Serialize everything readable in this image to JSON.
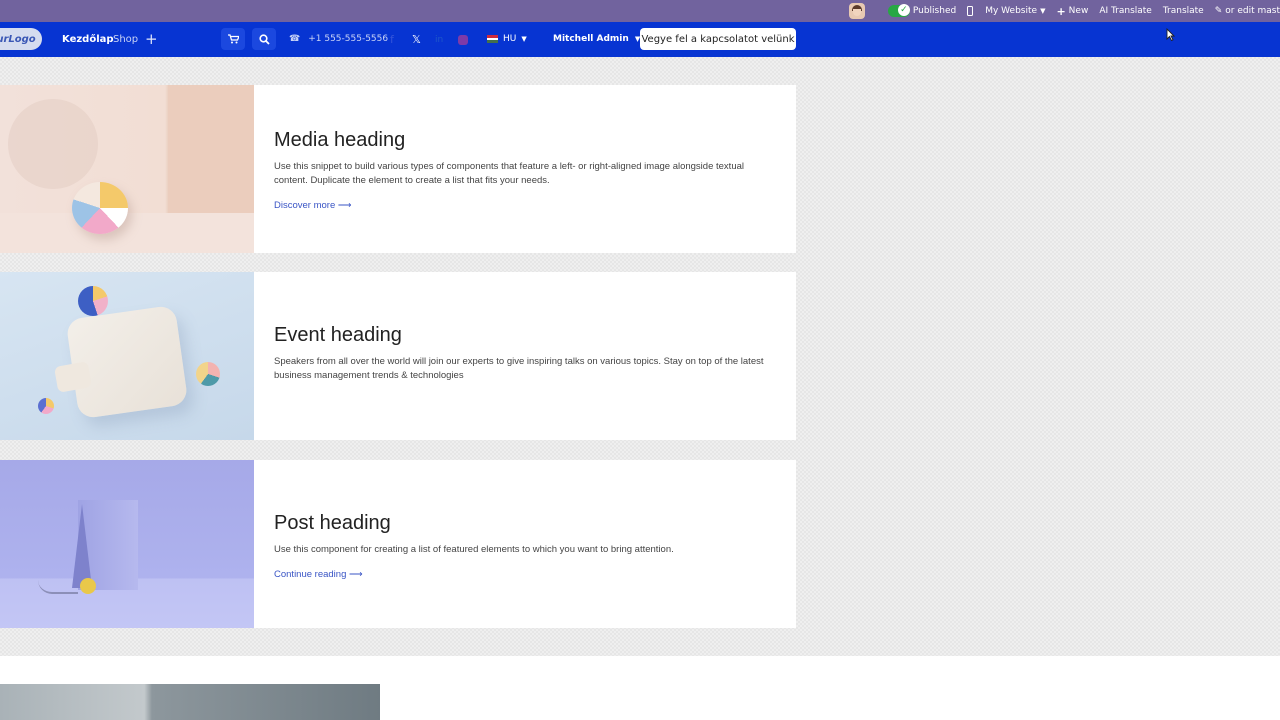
{
  "admin_bar": {
    "published_label": "Published",
    "website_label": "My Website",
    "new_label": "New",
    "ai_translate_label": "AI Translate",
    "translate_label": "Translate",
    "edit_label": "or edit mast"
  },
  "navbar": {
    "logo_text": "urLogo",
    "home_label": "Kezdőlap",
    "shop_label": "Shop",
    "phone": "+1 555-555-5556",
    "lang_code": "HU",
    "user_name": "Mitchell Admin",
    "cta_label": "Vegye fel a kapcsolatot velünk"
  },
  "cards": [
    {
      "heading": "Media heading",
      "body": "Use this snippet to build various types of components that feature a left- or right-aligned image alongside textual content. Duplicate the element to create a list that fits your needs.",
      "link": "Discover more"
    },
    {
      "heading": "Event heading",
      "body": "Speakers from all over the world will join our experts to give inspiring talks on various topics. Stay on top of the latest business management trends & technologies"
    },
    {
      "heading": "Post heading",
      "body": "Use this component for creating a list of featured elements to which you want to bring attention.",
      "link": "Continue reading"
    }
  ],
  "colors": {
    "admin_bar": "#71639e",
    "navbar": "#0734d2",
    "link": "#3a55c5"
  }
}
